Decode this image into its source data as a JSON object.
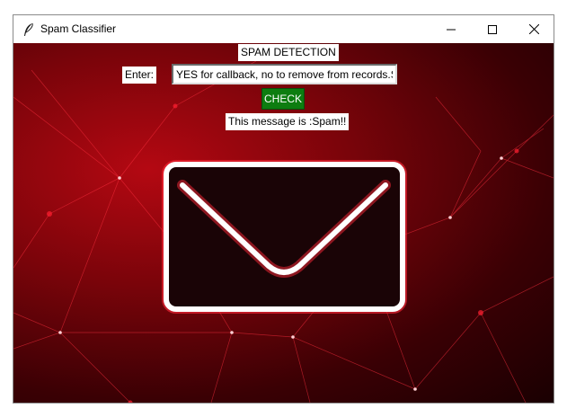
{
  "window": {
    "title": "Spam Classifier"
  },
  "app": {
    "heading": "SPAM DETECTION",
    "entry_label": "Enter:",
    "entry_value": "YES for callback, no to remove from records.S",
    "check_label": "CHECK",
    "result_text": "This message is :Spam!!"
  },
  "icons": {
    "app": "feather-icon",
    "minimize": "minimize-icon",
    "maximize": "maximize-icon",
    "close": "close-icon",
    "envelope": "envelope-icon"
  },
  "colors": {
    "check_bg": "#0d7d10",
    "background": "#8a0610",
    "envelope_stroke": "#ffffff",
    "envelope_glow": "#ff2a3a"
  }
}
